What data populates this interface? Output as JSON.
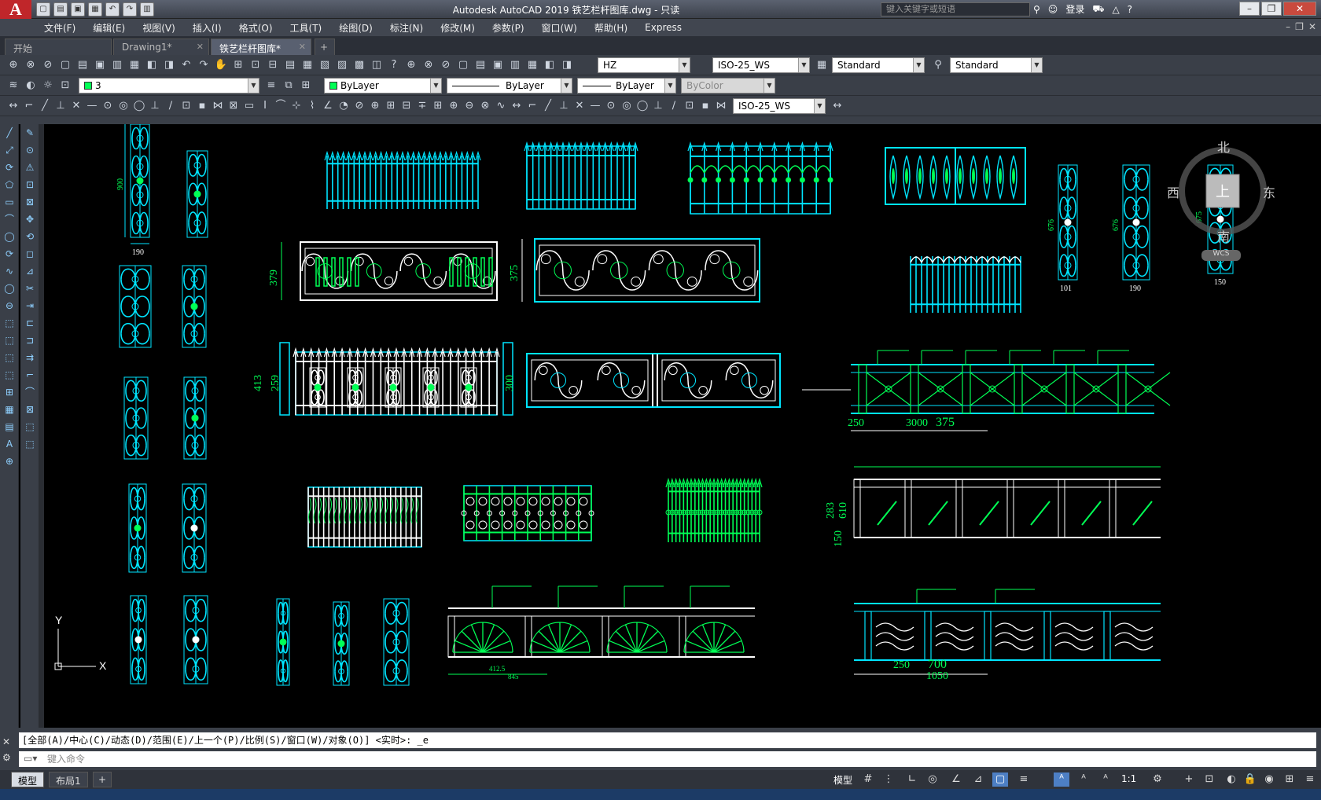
{
  "titlebar": {
    "app_logo": "A",
    "title": "Autodesk AutoCAD 2019    铁艺栏杆图库.dwg - 只读",
    "search_placeholder": "键入关键字或短语",
    "login": "登录",
    "win_min": "–",
    "win_restore": "❐",
    "win_close": "✕"
  },
  "menubar": {
    "items": [
      "文件(F)",
      "编辑(E)",
      "视图(V)",
      "插入(I)",
      "格式(O)",
      "工具(T)",
      "绘图(D)",
      "标注(N)",
      "修改(M)",
      "参数(P)",
      "窗口(W)",
      "帮助(H)",
      "Express"
    ]
  },
  "tabs": [
    {
      "label": "开始"
    },
    {
      "label": "Drawing1*"
    },
    {
      "label": "铁艺栏杆图库*"
    }
  ],
  "toolbar_styles": {
    "text_style": "HZ",
    "dim_style": "ISO-25_WS",
    "table_style": "Standard",
    "multileader_style": "Standard"
  },
  "toolbar_layers": {
    "layer": "3",
    "color": "ByLayer",
    "linetype": "ByLayer",
    "lineweight": "ByLayer",
    "plotstyle": "ByColor"
  },
  "toolbar_dims": {
    "dim_style": "ISO-25_WS"
  },
  "viewcube": {
    "north": "北",
    "south": "南",
    "east": "东",
    "west": "西",
    "top": "上",
    "wcs": "WCS"
  },
  "ucs": {
    "x": "X",
    "y": "Y"
  },
  "dimensions": {
    "d900": "900",
    "d190a": "190",
    "d379": "379",
    "d375": "375",
    "d413": "413",
    "d259": "259",
    "d300": "300",
    "d676a": "676",
    "d676b": "676",
    "d675": "675",
    "d101": "101",
    "d190b": "190",
    "d150": "150",
    "d3000": "3000",
    "d375b": "375",
    "d250": "250",
    "d700": "700",
    "d250b": "250",
    "d1050": "1050",
    "d283": "283",
    "d610": "610",
    "d150b": "150",
    "d412": "412.5",
    "d845": "845"
  },
  "command": {
    "history": "[全部(A)/中心(C)/动态(D)/范围(E)/上一个(P)/比例(S)/窗口(W)/对象(O)] <实时>: _e",
    "placeholder": "键入命令"
  },
  "statusbar": {
    "model_tab": "模型",
    "layout_tab": "布局1",
    "add_tab": "+",
    "model_label": "模型",
    "scale": "1:1"
  },
  "colors": {
    "cyan": "#00e5ff",
    "green": "#00ff55",
    "white": "#ffffff",
    "background": "#000000"
  }
}
